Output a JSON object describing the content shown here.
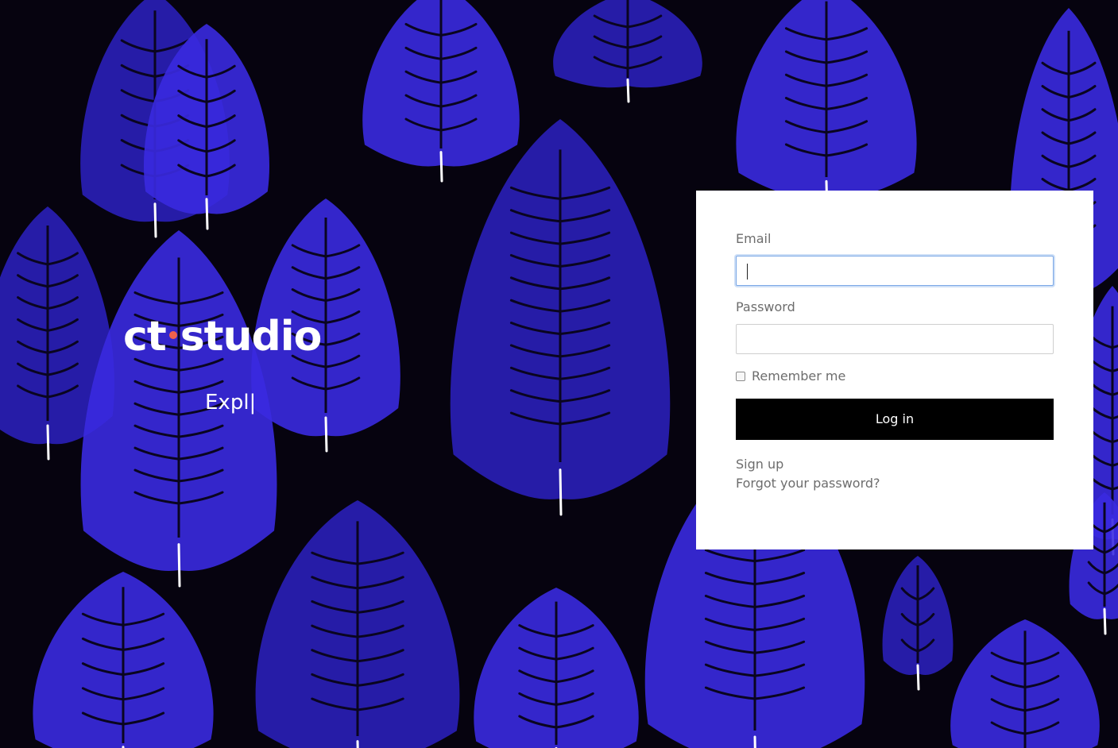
{
  "brand": {
    "logo_left": "ct",
    "logo_right": "studio",
    "dot_color": "#f0614c",
    "typed_text": "Expl|"
  },
  "background": {
    "base_color": "#06030f",
    "leaf_color": "#3a2ae0",
    "leaf_shade": "#2a1fb8"
  },
  "login": {
    "email_label": "Email",
    "email_value": "",
    "password_label": "Password",
    "password_value": "",
    "remember_label": "Remember me",
    "remember_checked": false,
    "submit_label": "Log in",
    "signup_link": "Sign up",
    "forgot_link": "Forgot your password?"
  }
}
